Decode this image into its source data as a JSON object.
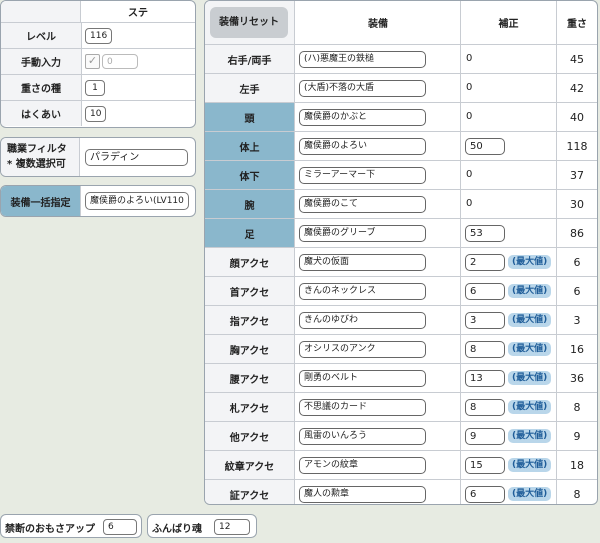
{
  "stats": {
    "header": "ステ",
    "rows": [
      {
        "label": "レベル",
        "value": "116"
      },
      {
        "label": "手動入力",
        "value": "0"
      },
      {
        "label": "重さの種",
        "value": "1"
      },
      {
        "label": "はくあい",
        "value": "10"
      }
    ]
  },
  "job_filter": {
    "label_line1": "職業フィルタ",
    "label_line2": "* 複数選択可",
    "value": "パラディン"
  },
  "bulk_equip": {
    "label": "装備一括指定",
    "value": "魔侯爵のよろい(LV110"
  },
  "table": {
    "reset_button": "装備リセット",
    "col_equip": "装備",
    "col_correction": "補正",
    "col_weight": "重さ",
    "max_label": "(最大値)",
    "rows": [
      {
        "slot": "右手/両手",
        "equip": "(ハ)悪魔王の鉄槌",
        "correction": "0",
        "weight": "45"
      },
      {
        "slot": "左手",
        "equip": "(大盾)不落の大盾",
        "correction": "0",
        "weight": "42"
      },
      {
        "slot": "頭",
        "equip": "魔侯爵のかぶと",
        "correction": "0",
        "weight": "40"
      },
      {
        "slot": "体上",
        "equip": "魔侯爵のよろい",
        "correction": "50",
        "weight": "118"
      },
      {
        "slot": "体下",
        "equip": "ミラーアーマー下",
        "correction": "0",
        "weight": "37"
      },
      {
        "slot": "腕",
        "equip": "魔侯爵のこて",
        "correction": "0",
        "weight": "30"
      },
      {
        "slot": "足",
        "equip": "魔侯爵のグリーブ",
        "correction": "53",
        "weight": "86"
      },
      {
        "slot": "顔アクセ",
        "equip": "魔犬の仮面",
        "correction": "2",
        "weight": "6"
      },
      {
        "slot": "首アクセ",
        "equip": "きんのネックレス",
        "correction": "6",
        "weight": "6"
      },
      {
        "slot": "指アクセ",
        "equip": "きんのゆびわ",
        "correction": "3",
        "weight": "3"
      },
      {
        "slot": "胸アクセ",
        "equip": "オシリスのアンク",
        "correction": "8",
        "weight": "16"
      },
      {
        "slot": "腰アクセ",
        "equip": "剛勇のベルト",
        "correction": "13",
        "weight": "36"
      },
      {
        "slot": "札アクセ",
        "equip": "不思議のカード",
        "correction": "8",
        "weight": "8"
      },
      {
        "slot": "他アクセ",
        "equip": "風雷のいんろう",
        "correction": "9",
        "weight": "9"
      },
      {
        "slot": "紋章アクセ",
        "equip": "アモンの紋章",
        "correction": "15",
        "weight": "18"
      },
      {
        "slot": "証アクセ",
        "equip": "魔人の勲章",
        "correction": "6",
        "weight": "8"
      }
    ]
  },
  "bottom": {
    "forbidden_label": "禁断のおもさアップ",
    "forbidden_value": "6",
    "funbari_label": "ふんばり魂",
    "funbari_value": "12"
  }
}
